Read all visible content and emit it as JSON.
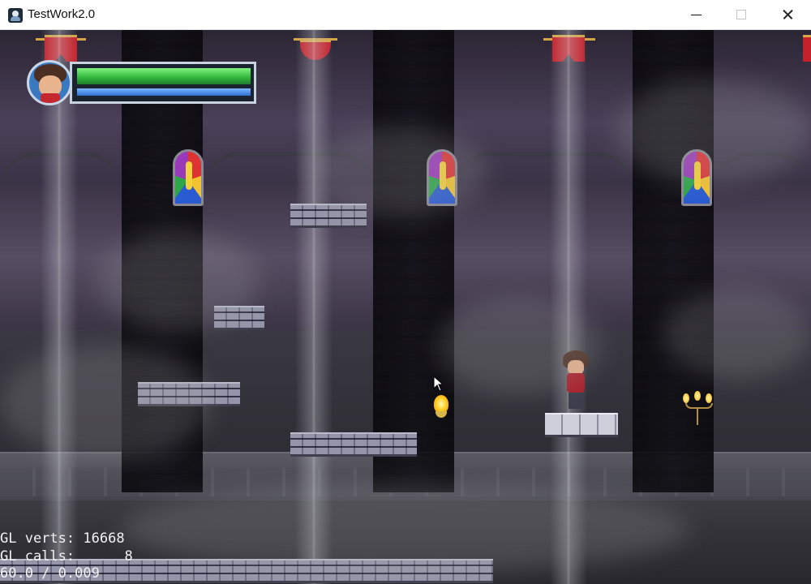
{
  "window": {
    "title": "TestWork2.0",
    "icon": "app-icon",
    "controls": {
      "minimize": "minimize-icon",
      "maximize": "maximize-icon",
      "close": "close-icon"
    }
  },
  "hud": {
    "portrait": "player-portrait",
    "health_fraction": 1.0,
    "mana_fraction": 1.0,
    "health_color": "#38c13f",
    "mana_color": "#2f6fd0"
  },
  "debug": {
    "verts_label": "GL verts:",
    "verts_value": "16668",
    "calls_label": "GL calls:",
    "calls_value": "8",
    "fps_line": "60.0 / 0.009"
  },
  "scene": {
    "icons": [
      "banner-icon",
      "stained-glass-window-icon",
      "torch-flame-icon",
      "candelabra-icon",
      "mouse-cursor-icon",
      "player-character"
    ]
  }
}
